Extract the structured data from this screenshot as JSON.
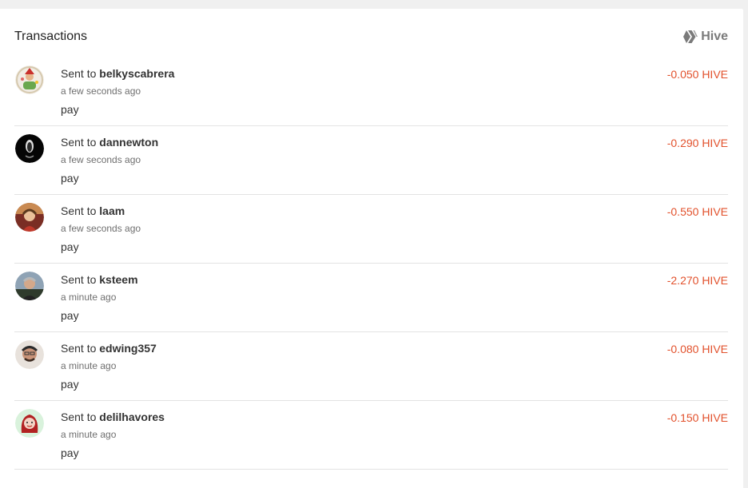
{
  "header": {
    "title": "Transactions",
    "brand_label": "Hive",
    "brand_icon": "hive-logo-icon"
  },
  "colors": {
    "amount_negative": "#e2512c",
    "page_bg": "#f0f0f0"
  },
  "transactions": [
    {
      "prefix": "Sent to",
      "user": "belkyscabrera",
      "time": "a few seconds ago",
      "memo": "pay",
      "amount": "-0.050 HIVE"
    },
    {
      "prefix": "Sent to",
      "user": "dannewton",
      "time": "a few seconds ago",
      "memo": "pay",
      "amount": "-0.290 HIVE"
    },
    {
      "prefix": "Sent to",
      "user": "laam",
      "time": "a few seconds ago",
      "memo": "pay",
      "amount": "-0.550 HIVE"
    },
    {
      "prefix": "Sent to",
      "user": "ksteem",
      "time": "a minute ago",
      "memo": "pay",
      "amount": "-2.270 HIVE"
    },
    {
      "prefix": "Sent to",
      "user": "edwing357",
      "time": "a minute ago",
      "memo": "pay",
      "amount": "-0.080 HIVE"
    },
    {
      "prefix": "Sent to",
      "user": "delilhavores",
      "time": "a minute ago",
      "memo": "pay",
      "amount": "-0.150 HIVE"
    }
  ]
}
